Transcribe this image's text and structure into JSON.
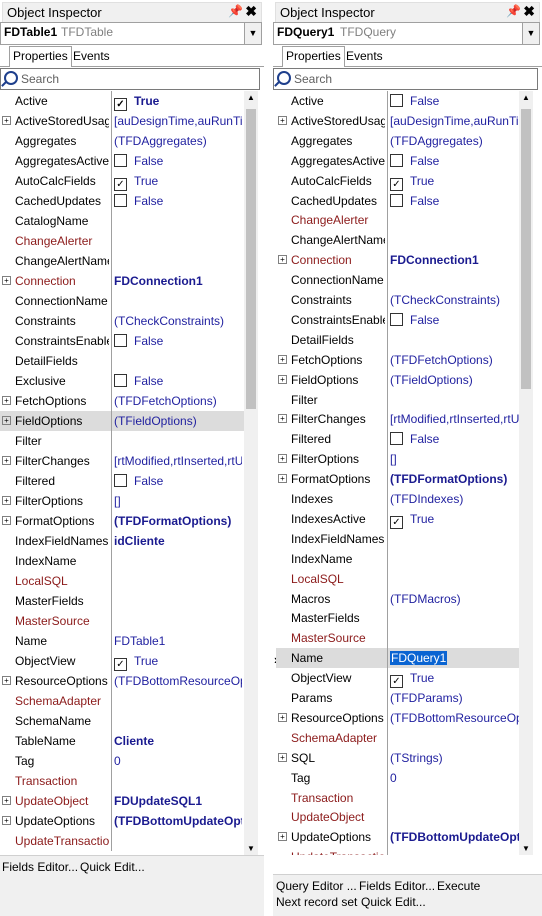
{
  "left": {
    "title": "Object Inspector",
    "object_name": "FDTable1",
    "object_class": "TFDTable",
    "tabs": [
      "Properties",
      "Events"
    ],
    "search_placeholder": "Search",
    "rows": [
      {
        "name": "Active",
        "value": "True",
        "check": true,
        "checked": true,
        "bold": true
      },
      {
        "name": "ActiveStoredUsage",
        "value": "[auDesignTime,auRunTime]",
        "expand": true
      },
      {
        "name": "Aggregates",
        "value": "(TFDAggregates)"
      },
      {
        "name": "AggregatesActive",
        "value": "False",
        "check": true,
        "checked": false
      },
      {
        "name": "AutoCalcFields",
        "value": "True",
        "check": true,
        "checked": true
      },
      {
        "name": "CachedUpdates",
        "value": "False",
        "check": true,
        "checked": false
      },
      {
        "name": "CatalogName",
        "value": ""
      },
      {
        "name": "ChangeAlerter",
        "value": "",
        "event": true
      },
      {
        "name": "ChangeAlertName",
        "value": ""
      },
      {
        "name": "Connection",
        "value": "FDConnection1",
        "expand": true,
        "event": true,
        "bold": true
      },
      {
        "name": "ConnectionName",
        "value": ""
      },
      {
        "name": "Constraints",
        "value": "(TCheckConstraints)"
      },
      {
        "name": "ConstraintsEnabled",
        "value": "False",
        "check": true,
        "checked": false
      },
      {
        "name": "DetailFields",
        "value": ""
      },
      {
        "name": "Exclusive",
        "value": "False",
        "check": true,
        "checked": false
      },
      {
        "name": "FetchOptions",
        "value": "(TFDFetchOptions)",
        "expand": true
      },
      {
        "name": "FieldOptions",
        "value": "(TFieldOptions)",
        "expand": true,
        "selected": true
      },
      {
        "name": "Filter",
        "value": ""
      },
      {
        "name": "FilterChanges",
        "value": "[rtModified,rtInserted,rtUnmodified]",
        "expand": true
      },
      {
        "name": "Filtered",
        "value": "False",
        "check": true,
        "checked": false
      },
      {
        "name": "FilterOptions",
        "value": "[]",
        "expand": true
      },
      {
        "name": "FormatOptions",
        "value": "(TFDFormatOptions)",
        "expand": true,
        "bold": true
      },
      {
        "name": "IndexFieldNames",
        "value": "idCliente",
        "bold": true
      },
      {
        "name": "IndexName",
        "value": ""
      },
      {
        "name": "LocalSQL",
        "value": "",
        "event": true
      },
      {
        "name": "MasterFields",
        "value": ""
      },
      {
        "name": "MasterSource",
        "value": "",
        "event": true
      },
      {
        "name": "Name",
        "value": "FDTable1",
        "plain": true
      },
      {
        "name": "ObjectView",
        "value": "True",
        "check": true,
        "checked": true
      },
      {
        "name": "ResourceOptions",
        "value": "(TFDBottomResourceOptions)",
        "expand": true
      },
      {
        "name": "SchemaAdapter",
        "value": "",
        "event": true
      },
      {
        "name": "SchemaName",
        "value": ""
      },
      {
        "name": "TableName",
        "value": "Cliente",
        "bold": true
      },
      {
        "name": "Tag",
        "value": "0"
      },
      {
        "name": "Transaction",
        "value": "",
        "event": true
      },
      {
        "name": "UpdateObject",
        "value": "FDUpdateSQL1",
        "expand": true,
        "event": true,
        "bold": true
      },
      {
        "name": "UpdateOptions",
        "value": "(TFDBottomUpdateOptions)",
        "expand": true,
        "bold": true
      },
      {
        "name": "UpdateTransaction",
        "value": "",
        "event": true
      }
    ],
    "footer": [
      "Fields Editor...",
      "Quick Edit..."
    ]
  },
  "right": {
    "title": "Object Inspector",
    "object_name": "FDQuery1",
    "object_class": "TFDQuery",
    "tabs": [
      "Properties",
      "Events"
    ],
    "search_placeholder": "Search",
    "rows": [
      {
        "name": "Active",
        "value": "False",
        "check": true,
        "checked": false
      },
      {
        "name": "ActiveStoredUsage",
        "value": "[auDesignTime,auRunTime]",
        "expand": true
      },
      {
        "name": "Aggregates",
        "value": "(TFDAggregates)"
      },
      {
        "name": "AggregatesActive",
        "value": "False",
        "check": true,
        "checked": false
      },
      {
        "name": "AutoCalcFields",
        "value": "True",
        "check": true,
        "checked": true
      },
      {
        "name": "CachedUpdates",
        "value": "False",
        "check": true,
        "checked": false
      },
      {
        "name": "ChangeAlerter",
        "value": "",
        "event": true
      },
      {
        "name": "ChangeAlertName",
        "value": ""
      },
      {
        "name": "Connection",
        "value": "FDConnection1",
        "expand": true,
        "event": true,
        "bold": true
      },
      {
        "name": "ConnectionName",
        "value": ""
      },
      {
        "name": "Constraints",
        "value": "(TCheckConstraints)"
      },
      {
        "name": "ConstraintsEnabled",
        "value": "False",
        "check": true,
        "checked": false
      },
      {
        "name": "DetailFields",
        "value": ""
      },
      {
        "name": "FetchOptions",
        "value": "(TFDFetchOptions)",
        "expand": true
      },
      {
        "name": "FieldOptions",
        "value": "(TFieldOptions)",
        "expand": true
      },
      {
        "name": "Filter",
        "value": ""
      },
      {
        "name": "FilterChanges",
        "value": "[rtModified,rtInserted,rtUnmodified]",
        "expand": true
      },
      {
        "name": "Filtered",
        "value": "False",
        "check": true,
        "checked": false
      },
      {
        "name": "FilterOptions",
        "value": "[]",
        "expand": true
      },
      {
        "name": "FormatOptions",
        "value": "(TFDFormatOptions)",
        "expand": true,
        "bold": true
      },
      {
        "name": "Indexes",
        "value": "(TFDIndexes)"
      },
      {
        "name": "IndexesActive",
        "value": "True",
        "check": true,
        "checked": true
      },
      {
        "name": "IndexFieldNames",
        "value": ""
      },
      {
        "name": "IndexName",
        "value": ""
      },
      {
        "name": "LocalSQL",
        "value": "",
        "event": true
      },
      {
        "name": "Macros",
        "value": "(TFDMacros)"
      },
      {
        "name": "MasterFields",
        "value": ""
      },
      {
        "name": "MasterSource",
        "value": "",
        "event": true
      },
      {
        "name": "Name",
        "value": "FDQuery1",
        "selected": true,
        "editing": true
      },
      {
        "name": "ObjectView",
        "value": "True",
        "check": true,
        "checked": true
      },
      {
        "name": "Params",
        "value": "(TFDParams)"
      },
      {
        "name": "ResourceOptions",
        "value": "(TFDBottomResourceOptions)",
        "expand": true
      },
      {
        "name": "SchemaAdapter",
        "value": "",
        "event": true
      },
      {
        "name": "SQL",
        "value": "(TStrings)",
        "expand": true
      },
      {
        "name": "Tag",
        "value": "0"
      },
      {
        "name": "Transaction",
        "value": "",
        "event": true
      },
      {
        "name": "UpdateObject",
        "value": "",
        "event": true
      },
      {
        "name": "UpdateOptions",
        "value": "(TFDBottomUpdateOptions)",
        "expand": true,
        "bold": true
      },
      {
        "name": "UpdateTransaction",
        "value": "",
        "event": true
      }
    ],
    "footer": [
      "Query Editor ...",
      "Fields Editor...",
      "Execute",
      "Next record set",
      "Quick Edit..."
    ]
  },
  "icons": {
    "pin": "pin-icon",
    "close": "close-icon",
    "search": "search-icon",
    "dropdown": "chevron-down-icon",
    "marker": "current-row-marker-icon"
  },
  "colors": {
    "value": "#1f1f9f",
    "event_name": "#8b1a1a",
    "selection": "#0a64d2"
  }
}
